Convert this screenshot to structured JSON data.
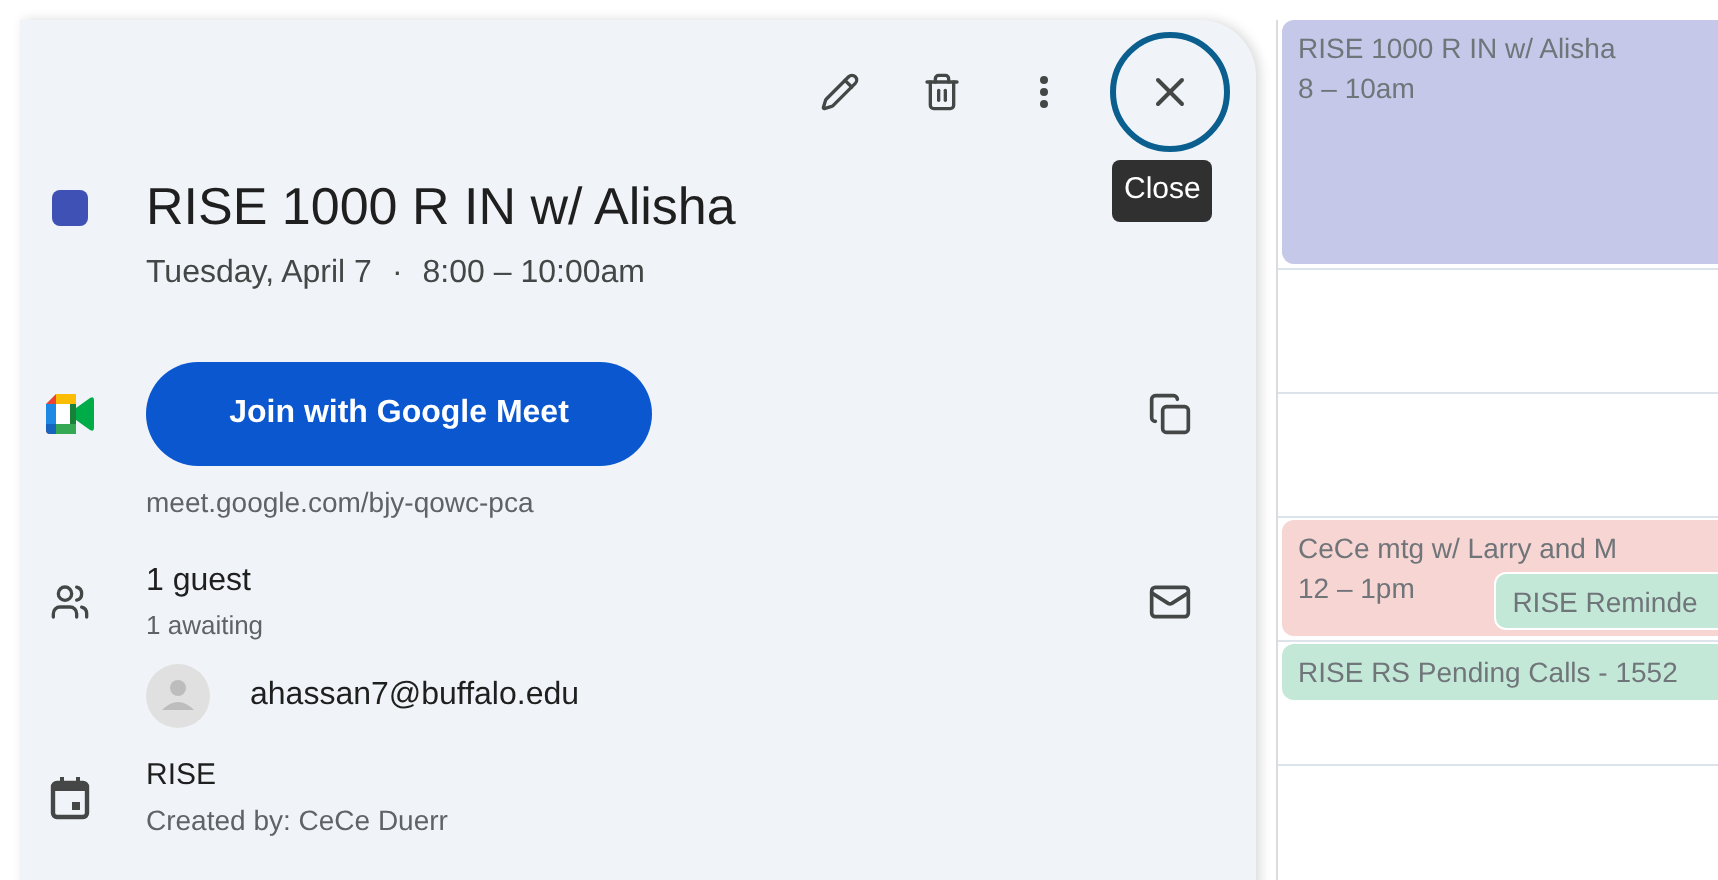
{
  "toolbar": {
    "tooltip": "Close"
  },
  "event": {
    "title": "RISE 1000 R IN w/ Alisha",
    "color": "#3f51b5",
    "date": "Tuesday, April 7",
    "separator": "·",
    "time": "8:00 – 10:00am"
  },
  "meet": {
    "button": "Join with Google Meet",
    "link": "meet.google.com/bjy-qowc-pca"
  },
  "guests": {
    "summary": "1 guest",
    "status": "1 awaiting",
    "list": [
      {
        "email": "ahassan7@buffalo.edu"
      }
    ]
  },
  "calendar": {
    "name": "RISE",
    "created_by": "Created by: CeCe Duerr"
  },
  "calendar_events": [
    {
      "kind": "long",
      "title": "RISE 1000 R IN w/ Alisha",
      "time": "8 – 10am",
      "color": "#c5c8e8"
    },
    {
      "kind": "long",
      "title": "CeCe mtg w/ Larry and M",
      "time": "12 – 1pm",
      "color": "#f6d5d2",
      "overlapping": [
        {
          "title": "RISE Reminde",
          "color": "#c4e8d8"
        }
      ]
    },
    {
      "kind": "short",
      "title": "RISE RS Pending Calls - 1552",
      "color": "#c4e8d8"
    }
  ]
}
